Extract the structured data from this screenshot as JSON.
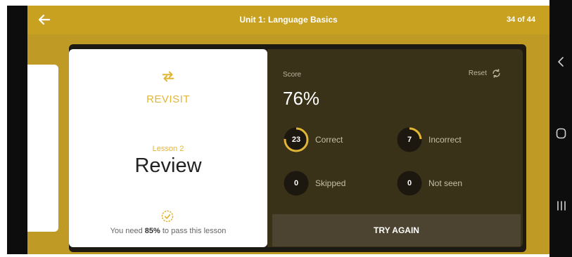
{
  "header": {
    "title": "Unit 1: Language Basics",
    "progress": "34 of 44"
  },
  "lesson_card": {
    "status": "REVISIT",
    "lesson_number": "Lesson 2",
    "lesson_title": "Review",
    "pass_note_prefix": "You need ",
    "pass_percent": "85%",
    "pass_note_suffix": " to pass this lesson"
  },
  "score": {
    "label": "Score",
    "reset_label": "Reset",
    "value": "76%",
    "stats": [
      {
        "count": "23",
        "label": "Correct",
        "fraction": 0.76
      },
      {
        "count": "7",
        "label": "Incorrect",
        "fraction": 0.24
      },
      {
        "count": "0",
        "label": "Skipped",
        "fraction": 0
      },
      {
        "count": "0",
        "label": "Not seen",
        "fraction": 0
      }
    ]
  },
  "actions": {
    "try_again_label": "TRY AGAIN"
  },
  "colors": {
    "accent": "#e2b634",
    "app_bg": "#bf9a25",
    "panel_bg": "#3a3218"
  },
  "icons": [
    "back-arrow-icon",
    "repeat-icon",
    "check-badge-icon",
    "refresh-icon",
    "nav-back-icon",
    "nav-home-icon",
    "nav-recents-icon"
  ]
}
